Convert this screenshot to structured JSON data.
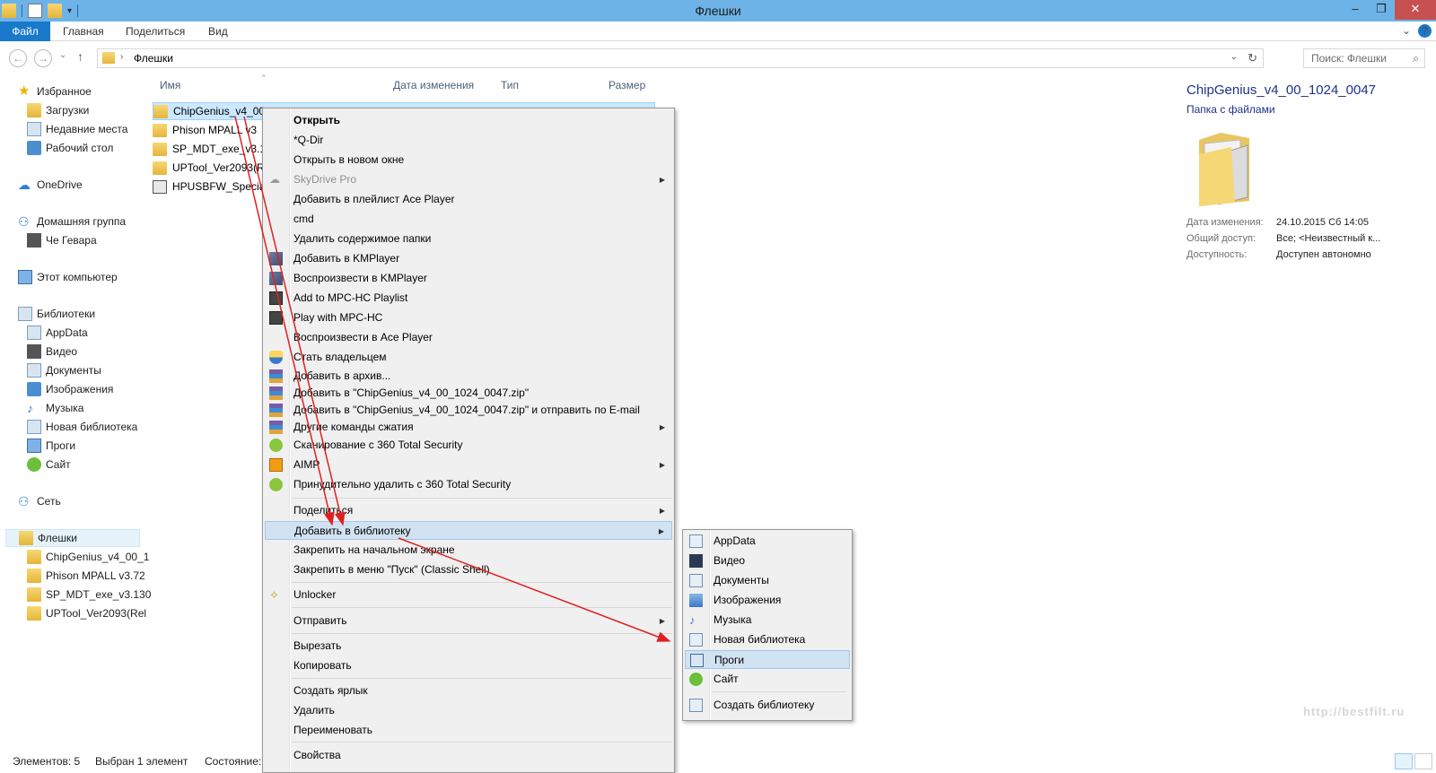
{
  "window": {
    "title": "Флешки",
    "minimize": "–",
    "maximize": "❐",
    "close": "✕"
  },
  "ribbon": {
    "tabs": [
      "Файл",
      "Главная",
      "Поделиться",
      "Вид"
    ],
    "expand": "⌄",
    "help": "?"
  },
  "address": {
    "back": "←",
    "forward": "→",
    "recent": "⌄",
    "up": "↑",
    "separator": "›",
    "path": "Флешки",
    "dropdown": "⌄",
    "refresh": "↻",
    "search_placeholder": "Поиск: Флешки",
    "search_icon": "⌕"
  },
  "navpane": {
    "favorites": "Избранное",
    "downloads": "Загрузки",
    "recent": "Недавние места",
    "desktop": "Рабочий стол",
    "onedrive": "OneDrive",
    "homegroup": "Домашняя группа",
    "homegroup_user": "Че Гевара",
    "computer": "Этот компьютер",
    "libraries": "Библиотеки",
    "lib_appdata": "AppData",
    "lib_video": "Видео",
    "lib_docs": "Документы",
    "lib_images": "Изображения",
    "lib_music": "Музыка",
    "lib_new": "Новая библиотека",
    "lib_progi": "Проги",
    "lib_site": "Сайт",
    "network": "Сеть",
    "flashki": "Флешки",
    "sub_1": "ChipGenius_v4_00_1",
    "sub_2": "Phison MPALL v3.72",
    "sub_3": "SP_MDT_exe_v3.130",
    "sub_4": "UPTool_Ver2093(Rel"
  },
  "filelist": {
    "columns": {
      "name": "Имя",
      "date": "Дата изменения",
      "type": "Тип",
      "size": "Размер"
    },
    "sort_indicator": "^",
    "files": [
      "ChipGenius_v4_00_",
      "Phison MPALL v3",
      "SP_MDT_exe_v3.1",
      "UPTool_Ver2093(R",
      "HPUSBFW_Specia"
    ]
  },
  "details": {
    "name": "ChipGenius_v4_00_1024_0047",
    "type": "Папка с файлами",
    "modified_label": "Дата изменения:",
    "modified_value": "24.10.2015 Сб 14:05",
    "sharing_label": "Общий доступ:",
    "sharing_value": "Все; <Неизвестный к...",
    "availability_label": "Доступность:",
    "availability_value": "Доступен автономно"
  },
  "context_menu": {
    "open": "Открыть",
    "qdir": "*Q-Dir",
    "open_new_window": "Открыть в новом окне",
    "skydrive": "SkyDrive Pro",
    "ace_playlist": "Добавить в плейлист Ace Player",
    "cmd": "cmd",
    "delete_contents": "Удалить содержимое папки",
    "km_add": "Добавить в KMPlayer",
    "km_play": "Воспроизвести в KMPlayer",
    "mpc_add": "Add to MPC-HC Playlist",
    "mpc_play": "Play with MPC-HC",
    "ace_play": "Воспроизвести в Ace Player",
    "take_owner": "Стать владельцем",
    "add_archive": "Добавить в архив...",
    "add_zip": "Добавить в \"ChipGenius_v4_00_1024_0047.zip\"",
    "add_zip_email": "Добавить в \"ChipGenius_v4_00_1024_0047.zip\" и отправить по E-mail",
    "other_compress": "Другие команды сжатия",
    "scan_360": "Сканирование с 360 Total Security",
    "aimp": "AIMP",
    "force_delete_360": "Принудительно удалить с  360 Total Security",
    "share": "Поделиться",
    "add_library": "Добавить в библиотеку",
    "pin_start": "Закрепить на начальном экране",
    "pin_classic": "Закрепить в меню \"Пуск\" (Classic Shell)",
    "unlocker": "Unlocker",
    "send_to": "Отправить",
    "cut": "Вырезать",
    "copy": "Копировать",
    "create_shortcut": "Создать ярлык",
    "delete": "Удалить",
    "rename": "Переименовать",
    "properties": "Свойства",
    "submenu_arrow": "▶"
  },
  "library_submenu": {
    "appdata": "AppData",
    "video": "Видео",
    "docs": "Документы",
    "images": "Изображения",
    "music": "Музыка",
    "new_library": "Новая библиотека",
    "progi": "Проги",
    "site": "Сайт",
    "create_library": "Создать библиотеку"
  },
  "status": {
    "items": "Элементов: 5",
    "selected": "Выбран 1 элемент",
    "state": "Состояние:"
  },
  "watermark": "http://bestfilt.ru",
  "colors": {
    "titlebar": "#6db3e8",
    "file_tab": "#1979ca",
    "selection": "#cce8ff",
    "menu_highlight": "#d1e2f2",
    "arrow": "#e02020"
  }
}
